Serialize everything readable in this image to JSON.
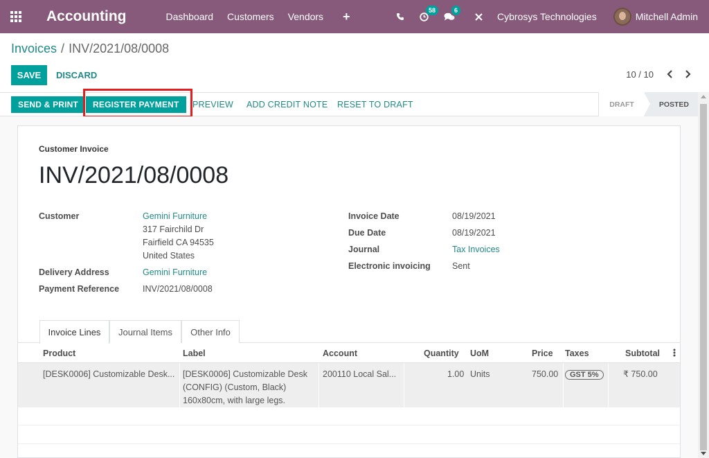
{
  "navbar": {
    "app_title": "Accounting",
    "menu": [
      "Dashboard",
      "Customers",
      "Vendors"
    ],
    "plus": "+",
    "activity_badge": "58",
    "messages_badge": "6",
    "company": "Cybrosys Technologies",
    "user": "Mitchell Admin",
    "bg_color": "#875a7b"
  },
  "breadcrumb": {
    "parent": "Invoices",
    "separator": "/",
    "current": "INV/2021/08/0008"
  },
  "controls": {
    "save_label": "SAVE",
    "discard_label": "DISCARD",
    "pager": "10 / 10"
  },
  "actions": {
    "send_print": "SEND & PRINT",
    "register_payment": "REGISTER PAYMENT",
    "preview": "PREVIEW",
    "add_credit_note": "ADD CREDIT NOTE",
    "reset_to_draft": "RESET TO DRAFT"
  },
  "states": {
    "draft": "DRAFT",
    "posted": "POSTED",
    "active": "POSTED"
  },
  "sheet": {
    "doc_type": "Customer Invoice",
    "title": "INV/2021/08/0008",
    "customer_label": "Customer",
    "customer_name": "Gemini Furniture",
    "customer_address_1": "317 Fairchild Dr",
    "customer_address_2": "Fairfield CA 94535",
    "customer_address_3": "United States",
    "delivery_label": "Delivery Address",
    "delivery_value": "Gemini Furniture",
    "payment_ref_label": "Payment Reference",
    "payment_ref_value": "INV/2021/08/0008",
    "invoice_date_label": "Invoice Date",
    "invoice_date_value": "08/19/2021",
    "due_date_label": "Due Date",
    "due_date_value": "08/19/2021",
    "journal_label": "Journal",
    "journal_value": "Tax Invoices",
    "einvoicing_label": "Electronic invoicing",
    "einvoicing_value": "Sent"
  },
  "tabs": [
    "Invoice Lines",
    "Journal Items",
    "Other Info"
  ],
  "table": {
    "headers": {
      "product": "Product",
      "label": "Label",
      "account": "Account",
      "quantity": "Quantity",
      "uom": "UoM",
      "price": "Price",
      "taxes": "Taxes",
      "subtotal": "Subtotal"
    },
    "rows": [
      {
        "product": "[DESK0006] Customizable Desk...",
        "label_1": "[DESK0006] Customizable Desk",
        "label_2": "(CONFIG) (Custom, Black)",
        "label_3": "160x80cm, with large legs.",
        "account": "200110 Local Sal...",
        "quantity": "1.00",
        "uom": "Units",
        "price": "750.00",
        "taxes": "GST 5%",
        "subtotal": "₹ 750.00"
      }
    ]
  },
  "colors": {
    "primary": "#00a09d",
    "link": "#1f8a87",
    "highlight": "#e02020"
  }
}
